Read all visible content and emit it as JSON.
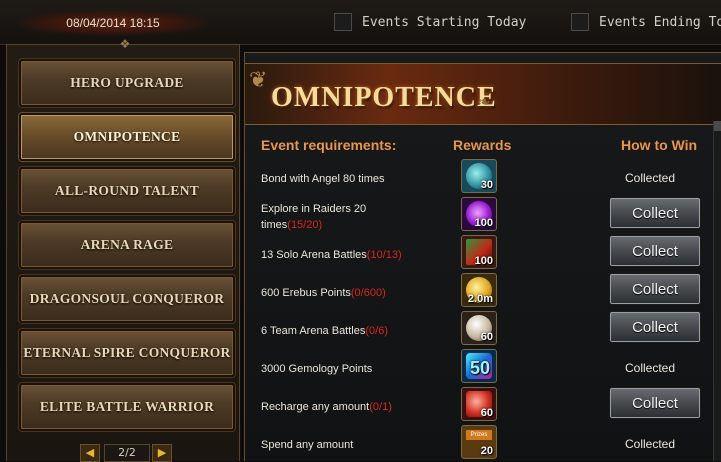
{
  "topbar": {
    "datetime": "08/04/2014 18:15",
    "filters": [
      {
        "label": "Events Starting Today",
        "checked": false
      },
      {
        "label": "Events Ending Today",
        "checked": false
      }
    ]
  },
  "sidebar": {
    "items": [
      {
        "label": "Hero Upgrade",
        "active": false
      },
      {
        "label": "Omnipotence",
        "active": true
      },
      {
        "label": "All-round Talent",
        "active": false
      },
      {
        "label": "Arena Rage",
        "active": false
      },
      {
        "label": "Dragonsoul Conqueror",
        "active": false
      },
      {
        "label": "Eternal Spire Conqueror",
        "active": false
      },
      {
        "label": "Elite Battle Warrior",
        "active": false
      }
    ],
    "pager": {
      "prev": "◀",
      "page": "2/2",
      "next": "▶"
    }
  },
  "main": {
    "title": "Omnipotence",
    "headers": {
      "requirements": "Event requirements:",
      "rewards": "Rewards",
      "how_to_win": "How to Win"
    },
    "rows": [
      {
        "req": "Bond with Angel 80 times",
        "progress": "",
        "reward_qty": "30",
        "reward_icon": "angel-crystal-icon",
        "status": "Collected",
        "state": "collected"
      },
      {
        "req": "Explore in Raiders 20 times",
        "progress": "(15/20)",
        "reward_qty": "100",
        "reward_icon": "purple-orb-icon",
        "status": "Collect",
        "state": "collect"
      },
      {
        "req": "13 Solo Arena Battles",
        "progress": "(10/13)",
        "reward_qty": "100",
        "reward_icon": "arena-swords-icon",
        "status": "Collect",
        "state": "collect"
      },
      {
        "req": "600 Erebus Points",
        "progress": "(0/600)",
        "reward_qty": "2.0m",
        "reward_icon": "gold-coin-icon",
        "status": "Collect",
        "state": "collect"
      },
      {
        "req": "6 Team Arena Battles",
        "progress": "(0/6)",
        "reward_qty": "60",
        "reward_icon": "pearl-icon",
        "status": "Collect",
        "state": "collect"
      },
      {
        "req": "3000 Gemology Points",
        "progress": "",
        "reward_qty": "50",
        "reward_icon": "gem-icon",
        "status": "Collected",
        "state": "collected"
      },
      {
        "req": "Recharge any amount",
        "progress": "(0/1)",
        "reward_qty": "60",
        "reward_icon": "red-gem-icon",
        "status": "Collect",
        "state": "collect"
      },
      {
        "req": "Spend any amount",
        "progress": "",
        "reward_qty": "20",
        "reward_icon": "prize-chest-icon",
        "reward_label": "Prizes",
        "status": "Collected",
        "state": "collected"
      }
    ]
  },
  "colors": {
    "accent": "#e8964a",
    "progress": "#d8281e",
    "title": "#f6dc9a"
  }
}
